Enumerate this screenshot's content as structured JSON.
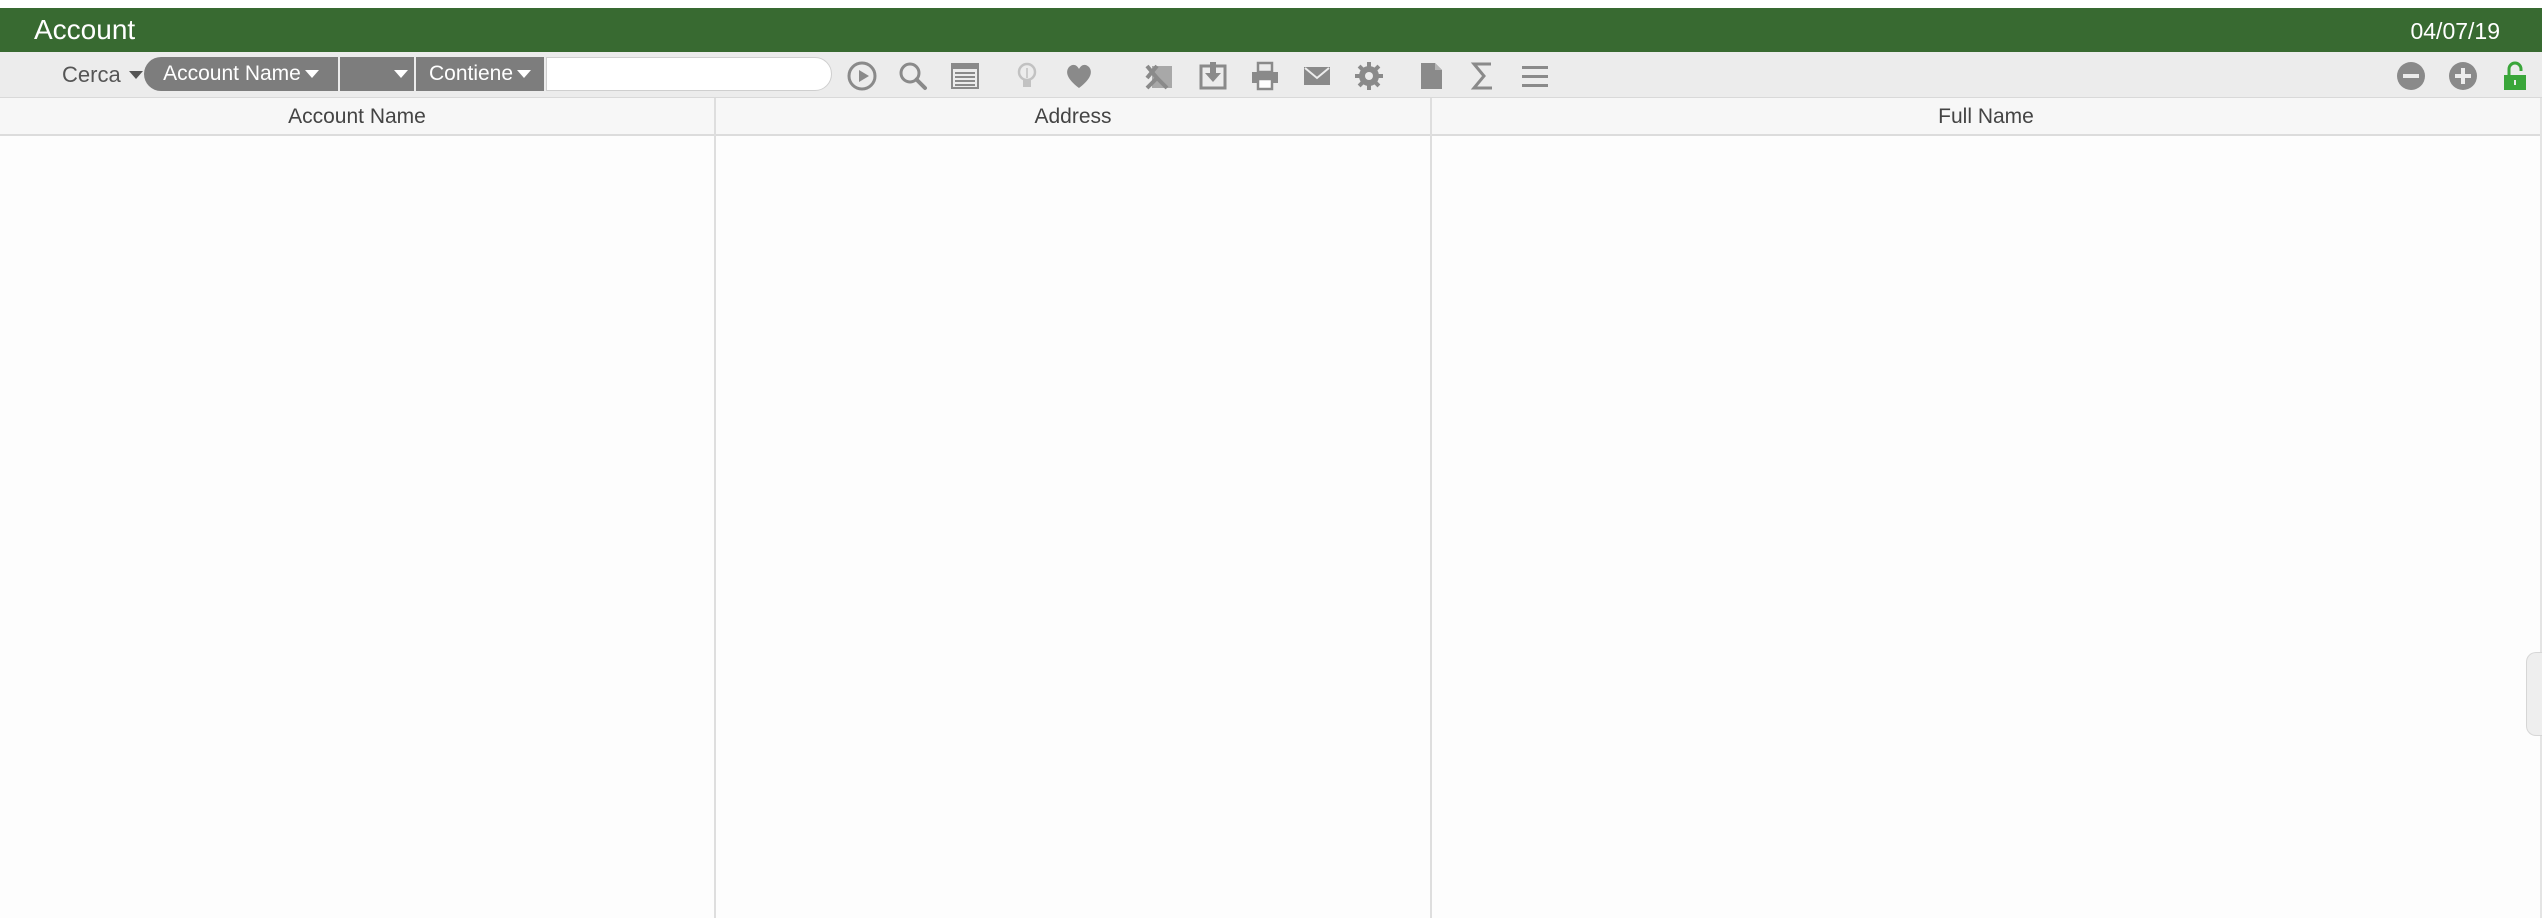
{
  "window": {
    "title": "Account",
    "date": "04/07/19"
  },
  "toolbar": {
    "search_label": "Cerca",
    "field_select": "Account Name",
    "blank_select": "",
    "operator_select": "Contiene",
    "search_value": "",
    "search_placeholder": "",
    "icons": [
      "play-icon",
      "search-icon",
      "list-icon",
      "lightbulb-icon",
      "heart-icon",
      "excel-export-icon",
      "download-icon",
      "print-icon",
      "mail-icon",
      "gear-icon",
      "document-icon",
      "sum-icon",
      "menu-icon",
      "minus-circle-icon",
      "plus-circle-icon",
      "unlock-icon"
    ]
  },
  "table": {
    "columns": [
      "Account Name",
      "Address",
      "Full Name"
    ],
    "rows": []
  },
  "colors": {
    "titlebar": "#386a31",
    "icon_gray": "#8a8a8a",
    "unlock_green": "#3aa63a"
  }
}
